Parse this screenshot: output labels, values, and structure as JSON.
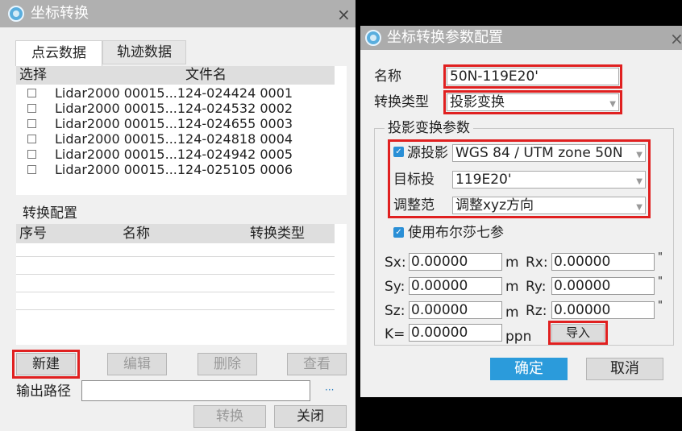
{
  "left_dialog": {
    "title": "坐标转换",
    "close": "×",
    "tabs": [
      {
        "label": "点云数据",
        "active": true
      },
      {
        "label": "轨迹数据",
        "active": false
      }
    ],
    "file_table": {
      "headers": {
        "select": "选择",
        "filename": "文件名"
      },
      "rows": [
        {
          "name": "Lidar2000 00015...124-024424 0001",
          "checked": false
        },
        {
          "name": "Lidar2000 00015...124-024532 0002",
          "checked": false
        },
        {
          "name": "Lidar2000 00015...124-024655 0003",
          "checked": false
        },
        {
          "name": "Lidar2000 00015...124-024818 0004",
          "checked": false
        },
        {
          "name": "Lidar2000 00015...124-024942 0005",
          "checked": false
        },
        {
          "name": "Lidar2000 00015...124-025105 0006",
          "checked": false
        }
      ]
    },
    "config_group": {
      "label": "转换配置",
      "headers": {
        "index": "序号",
        "name": "名称",
        "type": "转换类型"
      }
    },
    "buttons": {
      "new": "新建",
      "edit": "编辑",
      "delete": "删除",
      "view": "查看",
      "convert": "转换",
      "close": "关闭"
    },
    "output": {
      "label": "输出路径",
      "value": "",
      "browse": "···"
    }
  },
  "right_dialog": {
    "title": "坐标转换参数配置",
    "close": "×",
    "name_label": "名称",
    "name_value": "50N-119E20'",
    "type_label": "转换类型",
    "type_value": "投影变换",
    "projection_group": {
      "label": "投影变换参数",
      "source_label": "源投影",
      "source_value": "WGS 84 / UTM zone 50N",
      "target_label": "目标投",
      "target_value": "119E20'",
      "adjust_label": "调整范",
      "adjust_value": "调整xyz方向"
    },
    "bursa": {
      "label": "使用布尔莎七参",
      "checked": true
    },
    "params": {
      "sx_label": "Sx:",
      "sx": "0.00000",
      "sx_unit": "m",
      "sy_label": "Sy:",
      "sy": "0.00000",
      "sy_unit": "m",
      "sz_label": "Sz:",
      "sz": "0.00000",
      "sz_unit": "m",
      "rx_label": "Rx:",
      "rx": "0.00000",
      "rx_unit": "\"",
      "ry_label": "Ry:",
      "ry": "0.00000",
      "ry_unit": "\"",
      "rz_label": "Rz:",
      "rz": "0.00000",
      "rz_unit": "\"",
      "k_label": "K=",
      "k": "0.00000",
      "k_unit": "ppn"
    },
    "import": "导入",
    "ok": "确定",
    "cancel": "取消"
  },
  "colors": {
    "highlight": "#e02020",
    "accent": "#2b9bdb",
    "title_bar": "#b0b0b0",
    "overlay": "#000000"
  }
}
